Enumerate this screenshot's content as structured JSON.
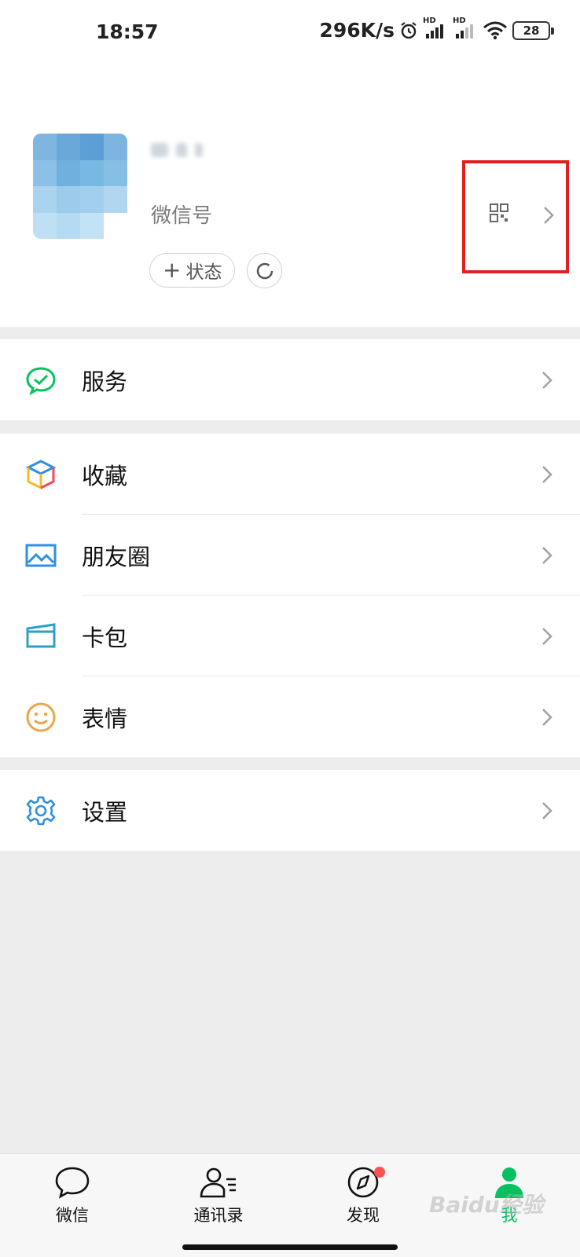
{
  "status_bar": {
    "time": "18:57",
    "speed": "296K/s",
    "signal_badges": [
      "HD",
      "HD"
    ],
    "battery": "28"
  },
  "profile": {
    "wechat_id_label": "微信号",
    "status_button_label": "状态",
    "status_plus": "+"
  },
  "menu": {
    "services": "服务",
    "favorites": "收藏",
    "moments": "朋友圈",
    "cards": "卡包",
    "stickers": "表情",
    "settings": "设置"
  },
  "tabbar": {
    "chats": "微信",
    "contacts": "通讯录",
    "discover": "发现",
    "me": "我"
  },
  "watermark": "Baidu经验",
  "colors": {
    "accent_green": "#07c160",
    "highlight_red": "#e02020",
    "badge_red": "#fa5151",
    "page_bg": "#ededed"
  }
}
